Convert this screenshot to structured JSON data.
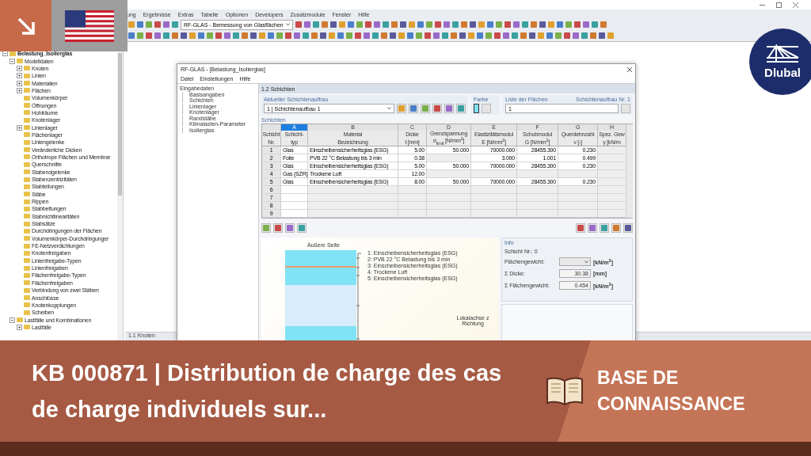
{
  "app": {
    "menu": [
      "ung",
      "Ergebnisse",
      "Extras",
      "Tabelle",
      "Optionen",
      "Developers",
      "Zusatzmodule",
      "Fenster",
      "Hilfe"
    ],
    "module_dropdown": "RF-GLAS - Bemessung von Glasflächen"
  },
  "navigator": {
    "tree": [
      {
        "label": "Belastung_Isolierglas",
        "expanded": true,
        "children": [
          {
            "label": "Modelldaten",
            "expanded": true,
            "children": [
              {
                "label": "Knoten",
                "expanded": false
              },
              {
                "label": "Linien",
                "expanded": false
              },
              {
                "label": "Materialien",
                "expanded": false
              },
              {
                "label": "Flächen",
                "expanded": false
              },
              {
                "label": "Volumenkörper"
              },
              {
                "label": "Öffnungen"
              },
              {
                "label": "Hohlräume"
              },
              {
                "label": "Knotenlager"
              },
              {
                "label": "Linienlager",
                "expanded": false
              },
              {
                "label": "Flächenlager"
              },
              {
                "label": "Liniengelenke"
              },
              {
                "label": "Veränderliche Dicken"
              },
              {
                "label": "Orthotrope Flächen und Membrar"
              },
              {
                "label": "Querschnitte"
              },
              {
                "label": "Stabendgelenke"
              },
              {
                "label": "Stabexzentrizitäten"
              },
              {
                "label": "Stabteilungen"
              },
              {
                "label": "Stäbe"
              },
              {
                "label": "Rippen"
              },
              {
                "label": "Stabbettungen"
              },
              {
                "label": "Stabnichtlinearitäten"
              },
              {
                "label": "Stabsätze"
              },
              {
                "label": "Durchdringungen der Flächen"
              },
              {
                "label": "Volumenkörper-Durchdringunger"
              },
              {
                "label": "FE-Netzverdichtungen"
              },
              {
                "label": "Knotenfreigaben"
              },
              {
                "label": "Linienfreigabe-Typen"
              },
              {
                "label": "Linienfreigaben"
              },
              {
                "label": "Flächenfreigabe-Typen"
              },
              {
                "label": "Flächenfreigaben"
              },
              {
                "label": "Verbindung von zwei Stäben"
              },
              {
                "label": "Anschlüsse"
              },
              {
                "label": "Knotenkopplungen"
              },
              {
                "label": "Scheiben"
              }
            ]
          },
          {
            "label": "Lastfälle und Kombinationen",
            "expanded": true,
            "children": [
              {
                "label": "Lastfälle",
                "expanded": false
              }
            ]
          }
        ]
      }
    ]
  },
  "dialog": {
    "title": "RF-GLAS - [Belastung_Isolierglas]",
    "menu": [
      "Datei",
      "Einstellungen",
      "Hilfe"
    ],
    "nav": {
      "label": "Eingabedaten",
      "children": [
        "Basisangaben",
        "Schichten",
        "Linienlager",
        "Knotenlager",
        "Randstäbe",
        "Klimalasten-Parameter",
        "Isolierglas"
      ]
    },
    "section_title": "1.2 Schichten",
    "current_build": {
      "label": "Aktueller Schichtenaufbau",
      "value": "1 | Schichtenaufbau 1"
    },
    "color": {
      "label": "Farbe",
      "color": "#7fe3f5"
    },
    "surfaces": {
      "label": "Liste der Flächen",
      "value": "1",
      "note": "Schichtenaufbau Nr. 1"
    },
    "table_title": "Schichten",
    "table": {
      "columns": [
        {
          "line1": "Schicht",
          "line2": "Nr.",
          "selected": false
        },
        {
          "letter": "A",
          "line1": "Schicht-",
          "line2": "typ",
          "selected": true
        },
        {
          "letter": "B",
          "line1": "Material",
          "line2": "Bezeichnung",
          "selected": false
        },
        {
          "letter": "C",
          "line1": "Dicke",
          "line2": "t [mm]",
          "selected": false
        },
        {
          "letter": "D",
          "line1": "Grenzspannung",
          "line2": "σ$_{limit}$ [N/mm$^{2}$]",
          "selected": false
        },
        {
          "letter": "E",
          "line1": "Elastizitätsmodul",
          "line2": "E [N/mm$^{2}$]",
          "selected": false
        },
        {
          "letter": "F",
          "line1": "Schubmodul",
          "line2": "G [N/mm$^{2}$]",
          "selected": false
        },
        {
          "letter": "G",
          "line1": "Querdehnzahl",
          "line2": "ν [-]",
          "selected": false
        },
        {
          "letter": "H",
          "line1": "Spez. Gew",
          "line2": "γ [kN/m",
          "selected": false
        }
      ],
      "rows": [
        {
          "cells": [
            "1",
            "Glas",
            "Einscheibensicherheitsglas (ESG)",
            "5.00",
            "50.000",
            "70000.000",
            "28455.300",
            "0.230",
            null
          ]
        },
        {
          "cells": [
            "2",
            "Folie",
            "PVB 22 °C Belastung bis 3 min",
            "0.38",
            null,
            "3.000",
            "1.001",
            "0.499",
            null
          ]
        },
        {
          "cells": [
            "3",
            "Glas",
            "Einscheibensicherheitsglas (ESG)",
            "5.00",
            "50.000",
            "70000.000",
            "28455.300",
            "0.230",
            null
          ]
        },
        {
          "cells": [
            "4",
            "Gas (SZR)",
            "Trockene Luft",
            "12.00",
            null,
            null,
            null,
            null,
            null
          ]
        },
        {
          "cells": [
            "5",
            "Glas",
            "Einscheibensicherheitsglas (ESG)",
            "8.00",
            "50.000",
            "70000.000",
            "28455.300",
            "0.230",
            null
          ]
        },
        {
          "cells": [
            "6",
            null,
            null,
            null,
            null,
            null,
            null,
            null,
            null
          ]
        },
        {
          "cells": [
            "7",
            null,
            null,
            null,
            null,
            null,
            null,
            null,
            null
          ]
        },
        {
          "cells": [
            "8",
            null,
            null,
            null,
            null,
            null,
            null,
            null,
            null
          ]
        },
        {
          "cells": [
            "9",
            null,
            null,
            null,
            null,
            null,
            null,
            null,
            null
          ]
        }
      ]
    },
    "graphic": {
      "top_label": "Äußere Seite",
      "legend": [
        "1: Einscheibensicherheitsglas (ESG)",
        "2: PVB 22 °C Belastung bis 3 min",
        "3: Einscheibensicherheitsglas (ESG)",
        "4: Trockene Luft",
        "5: Einscheibensicherheitsglas (ESG)"
      ],
      "axis_label": "Lokalachse z Richtung"
    },
    "info": {
      "title": "Info",
      "layer": "Schicht Nr.: 0",
      "rows": [
        {
          "kind": "dropdown",
          "label": "Flächengewicht:",
          "unit": "[kN/m$^{2}$]"
        },
        {
          "kind": "value",
          "label": "Σ Dicke:",
          "value": "30.38",
          "unit": "[mm]"
        },
        {
          "kind": "value",
          "label": "Σ Flächengewicht:",
          "value": "0.454",
          "unit": "[kN/m$^{2}$]"
        }
      ]
    }
  },
  "workspace_tab": "1.1 Knoten",
  "logo": {
    "text": "Dlubal"
  },
  "banner": {
    "title": "KB 000871 | Distribution de charge des cas de charge individuels sur...",
    "category": "BASE DE CONNAISSANCE"
  }
}
